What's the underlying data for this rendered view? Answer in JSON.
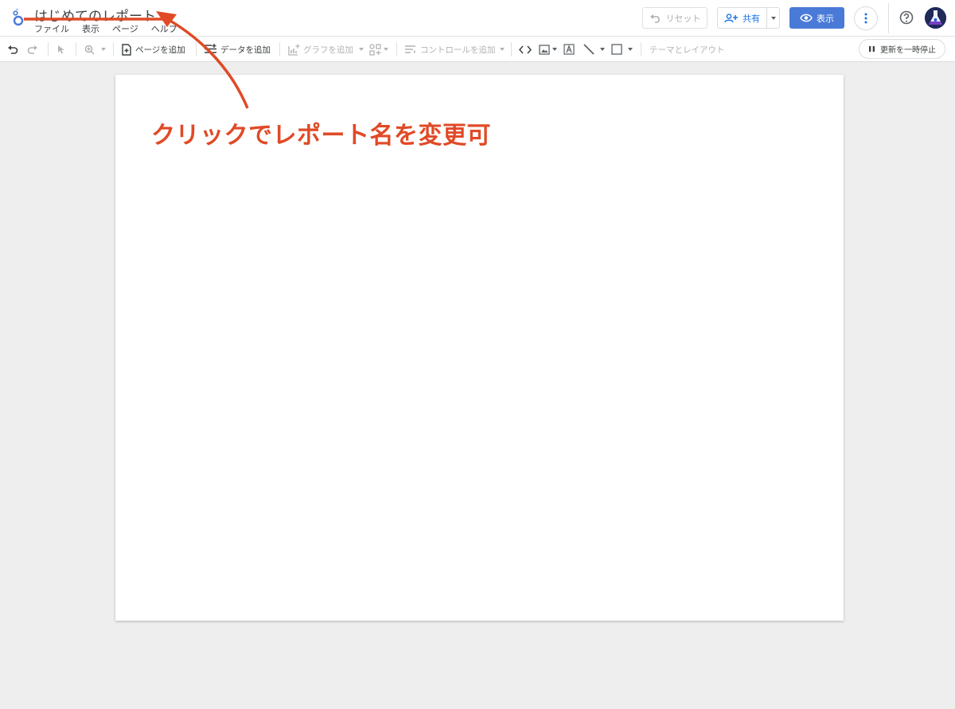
{
  "header": {
    "title": "はじめてのレポート",
    "menu": [
      "ファイル",
      "表示",
      "ページ",
      "ヘルプ"
    ],
    "reset_label": "リセット",
    "share_label": "共有",
    "view_label": "表示"
  },
  "toolbar": {
    "add_page": "ページを追加",
    "add_data": "データを追加",
    "add_chart": "グラフを追加",
    "add_control": "コントロールを追加",
    "theme_layout": "テーマとレイアウト",
    "pause_update": "更新を一時停止"
  },
  "annotation": {
    "text": "クリックでレポート名を変更可",
    "color": "#e04a26"
  },
  "colors": {
    "accent": "#4a7ad8",
    "link": "#1a73e8",
    "canvas_bg": "#eeeeee"
  },
  "icons": [
    "looker-studio-logo-icon",
    "undo-icon",
    "redo-icon",
    "select-cursor-icon",
    "zoom-icon",
    "add-page-icon",
    "add-data-icon",
    "add-chart-icon",
    "community-viz-icon",
    "control-icon",
    "code-icon",
    "image-icon",
    "text-icon",
    "line-icon",
    "rectangle-icon",
    "pause-icon",
    "more-vert-icon",
    "help-icon",
    "eye-icon",
    "add-person-icon"
  ]
}
